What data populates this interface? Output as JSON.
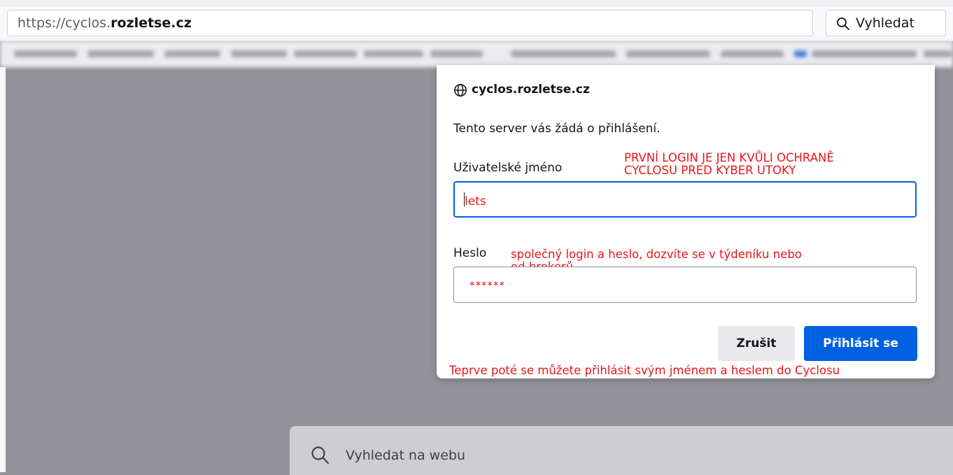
{
  "browser": {
    "url_prefix": "https://cyclos.",
    "url_domain": "rozletse.cz",
    "search_placeholder": "Vyhledat"
  },
  "auth_dialog": {
    "site": "cyclos.rozletse.cz",
    "message": "Tento server vás žádá o přihlášení.",
    "username_label": "Uživatelské jméno",
    "username_value": "lets",
    "password_label": "Heslo",
    "password_value": "******",
    "cancel_label": "Zrušit",
    "submit_label": "Přihlásit se"
  },
  "annotations": {
    "username_note_line1": "PRVNÍ LOGIN JE JEN KVŮLI OCHRANĚ",
    "username_note_line2": "CYCLOSU PŘED KYBER ÚTOKY",
    "password_note_line1": "společný login a heslo, dozvíte se v týdeníku nebo",
    "password_note_line2": "od brokerů",
    "bottom_note": "Teprve poté se můžete přihlásit svým jménem a heslem do Cyclosu"
  },
  "newtab": {
    "search_placeholder": "Vyhledat na webu"
  },
  "icons": {
    "globe": "globe-icon",
    "search": "search-icon"
  },
  "colors": {
    "accent": "#0061e0",
    "annotation": "#e8161a",
    "overlay": "#939399"
  }
}
